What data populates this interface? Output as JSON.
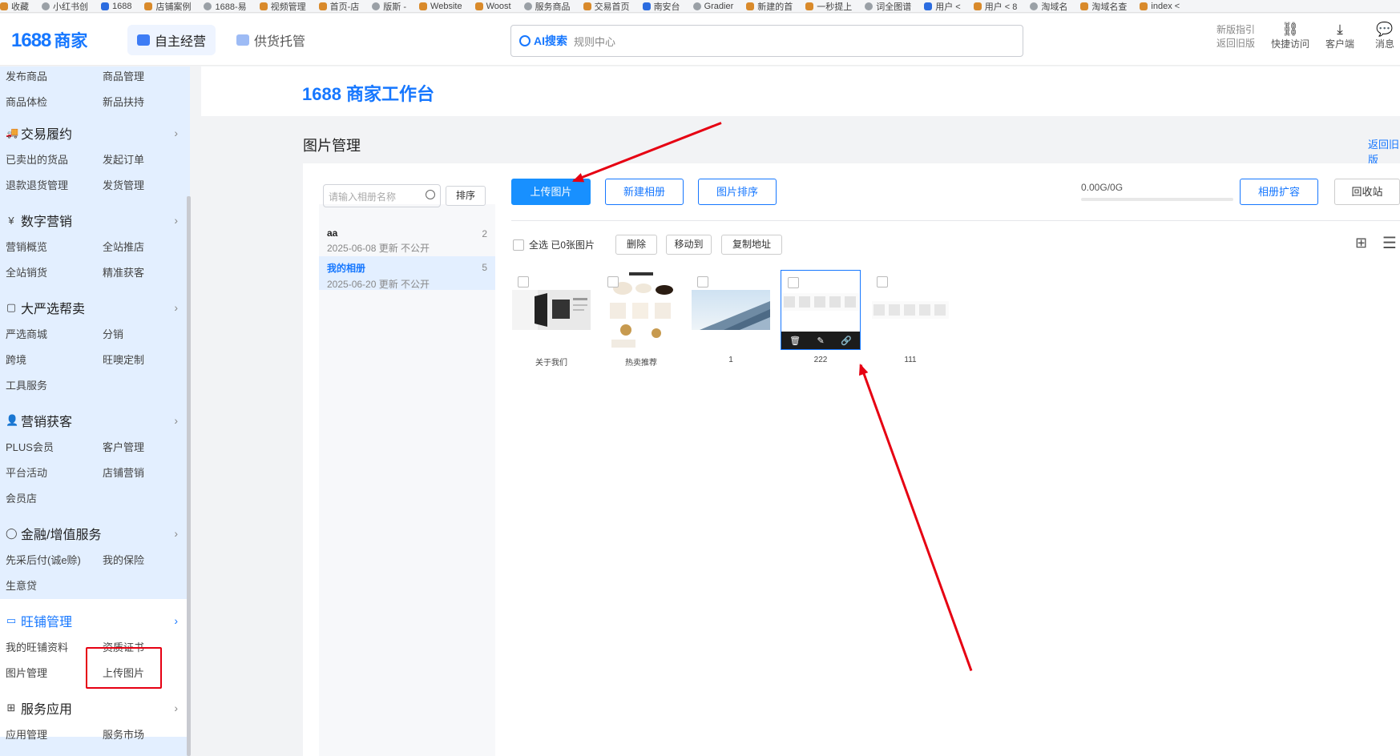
{
  "bookmarks": [
    "收藏",
    "小红书创",
    "1688",
    "店铺案例",
    "1688-易",
    "视频管理",
    "首页-店",
    "版斯 -",
    "Website",
    "Woost",
    "服务商品",
    "交易首页",
    "南安台",
    "Gradier",
    "新建的首",
    "一秒提上",
    "词全图谱",
    "用户 <",
    "用户 < 8",
    "淘域名",
    "淘域名查",
    "index <"
  ],
  "header": {
    "logo_num": "1688",
    "logo_text": "商家",
    "nav": [
      "自主经营",
      "供货托管"
    ],
    "search_ai": "AI搜索",
    "search_hint": "规则中心",
    "guide": "新版指引",
    "back_old_top": "返回旧版",
    "quick_access": "快捷访问",
    "client": "客户端",
    "message": "消息",
    "quick_icon": "⛓",
    "client_icon": "⤓",
    "message_icon": "💬"
  },
  "sidebar": {
    "top_items": [
      "发布商品",
      "商品管理",
      "商品体检",
      "新品扶持"
    ],
    "sections": [
      {
        "title": "交易履约",
        "icon": "🚚",
        "items": [
          "已卖出的货品",
          "发起订单",
          "退款退货管理",
          "发货管理"
        ]
      },
      {
        "title": "数字营销",
        "icon": "¥",
        "items": [
          "营销概览",
          "全站推店",
          "全站销货",
          "精准获客"
        ]
      },
      {
        "title": "大严选帮卖",
        "icon": "▢",
        "items": [
          "严选商城",
          "分销",
          "跨境",
          "旺噢定制",
          "工具服务"
        ]
      },
      {
        "title": "营销获客",
        "icon": "👤",
        "items": [
          "PLUS会员",
          "客户管理",
          "平台活动",
          "店铺营销",
          "会员店"
        ]
      },
      {
        "title": "金融/增值服务",
        "icon": "◯",
        "items": [
          "先采后付(诚e赊)",
          "我的保险",
          "生意贷"
        ]
      },
      {
        "title": "旺铺管理",
        "icon": "▭",
        "items": [
          "我的旺铺资料",
          "资质证书",
          "图片管理",
          "上传图片"
        ]
      },
      {
        "title": "服务应用",
        "icon": "⊞",
        "items": [
          "应用管理",
          "服务市场"
        ]
      }
    ]
  },
  "workbench_title": "1688 商家工作台",
  "page": {
    "title": "图片管理",
    "back_old": "返回旧版"
  },
  "albums": {
    "search_placeholder": "请输入相册名称",
    "sort_label": "排序",
    "list": [
      {
        "name": "aa",
        "meta": "2025-06-08 更新 不公开",
        "count": "2"
      },
      {
        "name": "我的相册",
        "meta": "2025-06-20 更新 不公开",
        "count": "5"
      }
    ]
  },
  "toolbar": {
    "upload": "上传图片",
    "new_album": "新建相册",
    "sort_images": "图片排序",
    "usage": "0.00G/0G",
    "usage_fraction": 0,
    "expand": "相册扩容",
    "recycle": "回收站",
    "select_all": "全选",
    "selected": "已0张图片",
    "delete": "删除",
    "move": "移动到",
    "copy": "复制地址",
    "grid_icon": "⊞",
    "list_icon": "☰"
  },
  "images": [
    {
      "caption": "关于我们"
    },
    {
      "caption": "热卖推荐"
    },
    {
      "caption": "1"
    },
    {
      "caption": "222"
    },
    {
      "caption": "111"
    }
  ],
  "image_actions": {
    "delete": "🗑",
    "edit": "✎",
    "link": "🔗"
  },
  "annotation_color": "#e60012",
  "accent_color": "#1677ff"
}
